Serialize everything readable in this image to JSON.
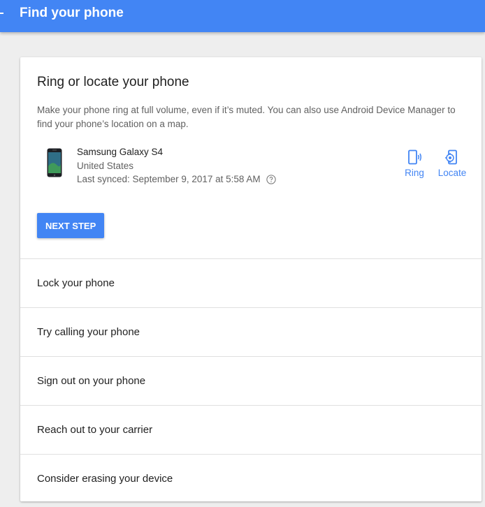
{
  "header": {
    "title": "Find your phone"
  },
  "card": {
    "title": "Ring or locate your phone",
    "description": "Make your phone ring at full volume, even if it’s muted. You can also use Android Device Manager to find your phone’s location on a map.",
    "device": {
      "name": "Samsung Galaxy S4",
      "location": "United States",
      "last_synced": "Last synced: September 9, 2017 at 5:58 AM"
    },
    "actions": {
      "ring_label": "Ring",
      "locate_label": "Locate"
    },
    "next_step_label": "NEXT STEP"
  },
  "steps": [
    {
      "label": "Lock your phone"
    },
    {
      "label": "Try calling your phone"
    },
    {
      "label": "Sign out on your phone"
    },
    {
      "label": "Reach out to your carrier"
    },
    {
      "label": "Consider erasing your device"
    }
  ],
  "colors": {
    "primary": "#4285f4",
    "text_primary": "#212121",
    "text_secondary": "#616161"
  }
}
